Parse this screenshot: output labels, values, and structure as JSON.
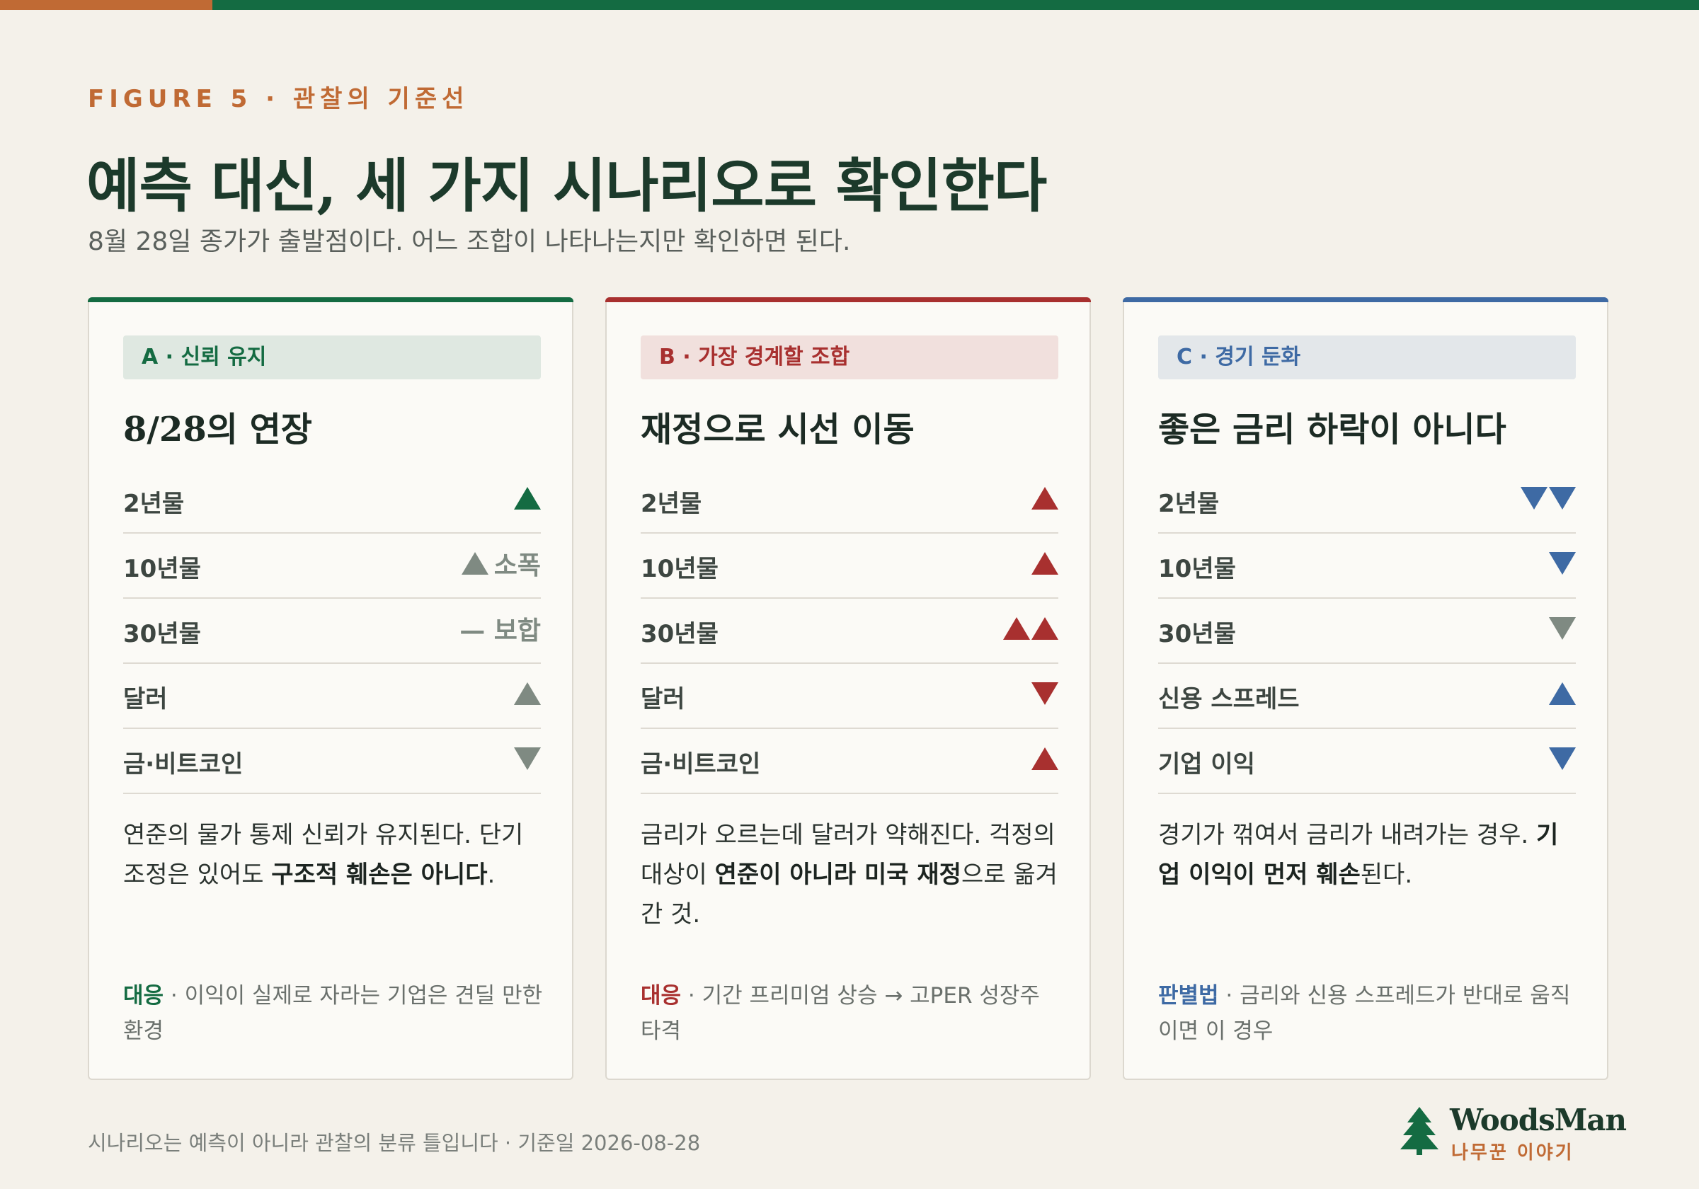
{
  "colors": {
    "green": "#146b42",
    "red": "#a8302f",
    "blue": "#3e6aa4",
    "gray": "#7f8a82",
    "orange": "#c06a34"
  },
  "header": {
    "kicker": "FIGURE 5 · 관찰의 기준선",
    "title": "예측 대신, 세 가지 시나리오로 확인한다",
    "subtitle": "8월 28일 종가가 출발점이다. 어느 조합이 나타나는지만 확인하면 된다."
  },
  "cards": [
    {
      "tag": "A · 신뢰 유지",
      "title": "8/28의 연장",
      "rows": [
        {
          "label": "2년물",
          "icon": "triangle-up-icon",
          "color": "green",
          "text": ""
        },
        {
          "label": "10년물",
          "icon": "triangle-up-icon",
          "color": "gray",
          "text": "소폭"
        },
        {
          "label": "30년물",
          "icon": "dash-icon",
          "color": "gray",
          "text": "— 보합"
        },
        {
          "label": "달러",
          "icon": "triangle-up-icon",
          "color": "gray",
          "text": ""
        },
        {
          "label": "금·비트코인",
          "icon": "triangle-down-icon",
          "color": "gray",
          "text": ""
        }
      ],
      "desc": {
        "pre": "연준의 물가 통제 신뢰가 유지된다. 단기 조정은 있어도 ",
        "bold": "구조적 훼손은 아니다",
        "post": "."
      },
      "note": {
        "label": "대응",
        "text": " · 이익이 실제로 자라는 기업은 견딜 만한 환경"
      }
    },
    {
      "tag": "B · 가장 경계할 조합",
      "title": "재정으로 시선 이동",
      "rows": [
        {
          "label": "2년물",
          "icon": "triangle-up-icon",
          "color": "red",
          "text": ""
        },
        {
          "label": "10년물",
          "icon": "triangle-up-icon",
          "color": "red",
          "text": ""
        },
        {
          "label": "30년물",
          "icon": "double-triangle-up-icon",
          "color": "red",
          "text": ""
        },
        {
          "label": "달러",
          "icon": "triangle-down-icon",
          "color": "red",
          "text": ""
        },
        {
          "label": "금·비트코인",
          "icon": "triangle-up-icon",
          "color": "red",
          "text": ""
        }
      ],
      "desc": {
        "pre": "금리가 오르는데 달러가 약해진다. 걱정의 대상이 ",
        "bold": "연준이 아니라 미국 재정",
        "post": "으로 옮겨 간 것."
      },
      "note": {
        "label": "대응",
        "text": " · 기간 프리미엄 상승 → 고PER 성장주 타격"
      }
    },
    {
      "tag": "C · 경기 둔화",
      "title": "좋은 금리 하락이 아니다",
      "rows": [
        {
          "label": "2년물",
          "icon": "double-triangle-down-icon",
          "color": "blue",
          "text": ""
        },
        {
          "label": "10년물",
          "icon": "triangle-down-icon",
          "color": "blue",
          "text": ""
        },
        {
          "label": "30년물",
          "icon": "triangle-down-icon",
          "color": "gray",
          "text": ""
        },
        {
          "label": "신용 스프레드",
          "icon": "triangle-up-icon",
          "color": "blue",
          "text": ""
        },
        {
          "label": "기업 이익",
          "icon": "triangle-down-icon",
          "color": "blue",
          "text": ""
        }
      ],
      "desc": {
        "pre": "경기가 꺾여서 금리가 내려가는 경우. ",
        "bold": "기업 이익이 먼저 훼손",
        "post": "된다."
      },
      "note": {
        "label": "판별법",
        "text": " · 금리와 신용 스프레드가 반대로 움직이면 이 경우"
      }
    }
  ],
  "footer": {
    "text": "시나리오는 예측이 아니라 관찰의 분류 틀입니다 · 기준일 2026-08-28"
  },
  "brand": {
    "name": "WoodsMan",
    "sub": "나무꾼 이야기",
    "icon": "pine-tree-icon"
  }
}
